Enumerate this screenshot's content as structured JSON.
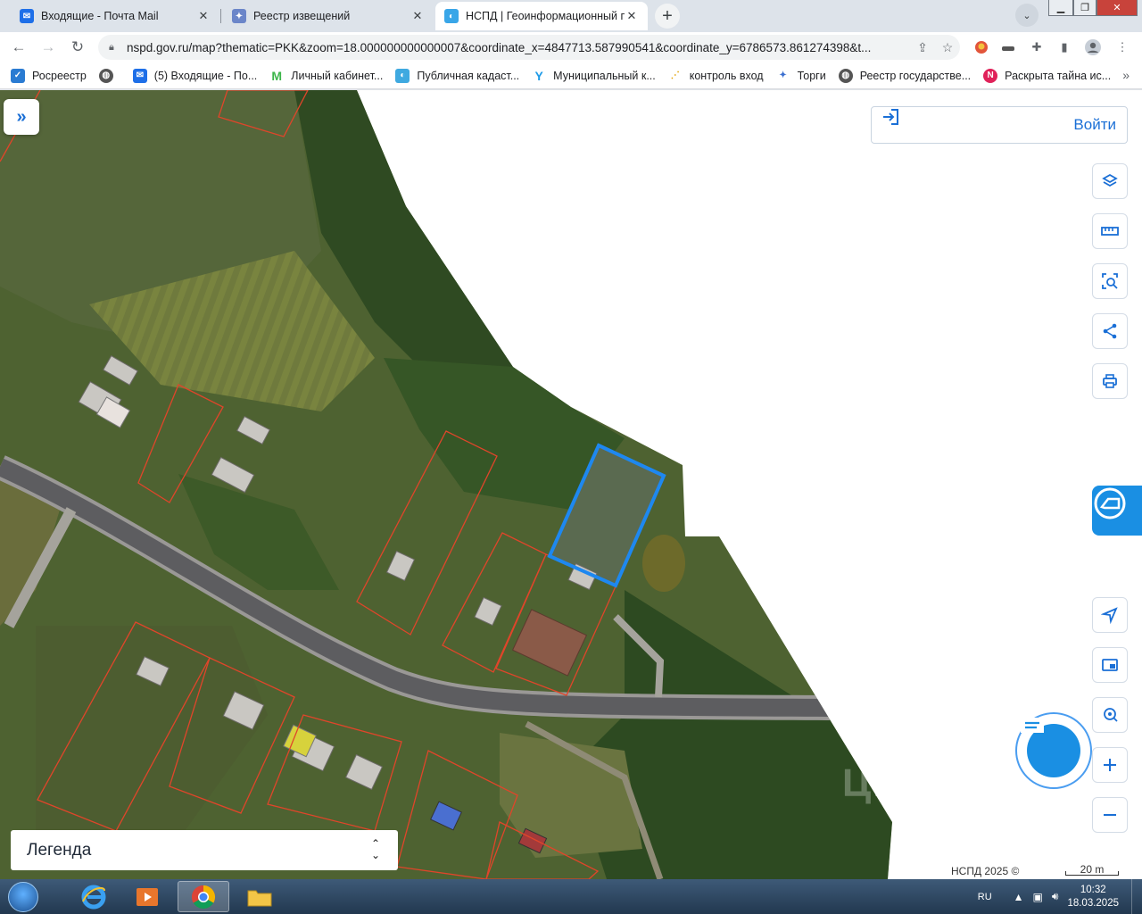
{
  "tabs": [
    {
      "title": "Входящие - Почта Mail",
      "icon": "mail-icon",
      "active": false
    },
    {
      "title": "Реестр извещений",
      "icon": "eagle-emblem-icon",
      "active": false
    },
    {
      "title": "НСПД | Геоинформационный п",
      "icon": "nspd-icon",
      "active": true
    }
  ],
  "address": {
    "url": "nspd.gov.ru/map?thematic=PKK&zoom=18.000000000000007&coordinate_x=4847713.587990541&coordinate_y=6786573.861274398&t..."
  },
  "bookmarks": [
    {
      "label": "Росреестр",
      "icon": "rosreestr-icon"
    },
    {
      "label": "",
      "icon": "globe-icon"
    },
    {
      "label": "(5) Входящие - По...",
      "icon": "mail-icon"
    },
    {
      "label": "Личный кабинет...",
      "icon": "m-logo-icon"
    },
    {
      "label": "Публичная кадаст...",
      "icon": "pkk-icon"
    },
    {
      "label": "Муниципальный к...",
      "icon": "y-logo-icon"
    },
    {
      "label": "контроль вход",
      "icon": "chart-icon"
    },
    {
      "label": "Торги",
      "icon": "emblem-icon"
    },
    {
      "label": "Реестр государстве...",
      "icon": "globe-icon"
    },
    {
      "label": "Раскрыта тайна ис...",
      "icon": "n-logo-icon"
    }
  ],
  "map": {
    "login_label": "Войти",
    "legend_label": "Легенда",
    "attribution": "НСПД 2025 ©",
    "scale_label": "20 m",
    "watermark": "ЦИАН"
  },
  "taskbar": {
    "lang": "RU",
    "time": "10:32",
    "date": "18.03.2025"
  },
  "colors": {
    "accent": "#1a6fd6",
    "selected_parcel": "#1e88f0",
    "parcel_outline": "#e0452a"
  }
}
